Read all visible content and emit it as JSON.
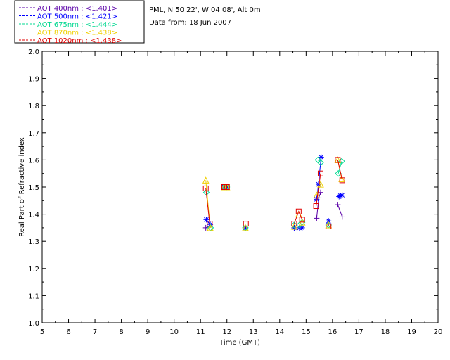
{
  "header": {
    "site_line": "PML, N 50 22', W 04 08', Alt 0m",
    "date_line": "Data from: 18 Jun 2007"
  },
  "chart_data": {
    "type": "scatter",
    "title": "",
    "xlabel": "Time (GMT)",
    "ylabel": "Real Part of Refractive index",
    "xlim": [
      5,
      20
    ],
    "ylim": [
      1.0,
      2.0
    ],
    "x_ticks": [
      5,
      6,
      7,
      8,
      9,
      10,
      11,
      12,
      13,
      14,
      15,
      16,
      17,
      18,
      19,
      20
    ],
    "y_ticks": [
      "1.0",
      "1.1",
      "1.2",
      "1.3",
      "1.4",
      "1.5",
      "1.6",
      "1.7",
      "1.8",
      "1.9",
      "2.0"
    ],
    "grid": false,
    "legend_position": "top-left",
    "series": [
      {
        "name": "AOT  400nm : <1.401>",
        "color": "#5a00a8",
        "marker": "plus",
        "segments": [
          [
            [
              11.2,
              1.35
            ],
            [
              11.35,
              1.355
            ]
          ],
          [
            [
              15.4,
              1.385
            ],
            [
              15.48,
              1.46
            ],
            [
              15.55,
              1.48
            ]
          ],
          [
            [
              16.2,
              1.435
            ],
            [
              16.37,
              1.39
            ]
          ]
        ],
        "points": [
          [
            11.9,
            1.5
          ],
          [
            12.0,
            1.5
          ],
          [
            12.7,
            1.35
          ],
          [
            14.55,
            1.35
          ],
          [
            14.75,
            1.35
          ],
          [
            15.85,
            1.365
          ]
        ]
      },
      {
        "name": "AOT  500nm : <1.421>",
        "color": "#0000ff",
        "marker": "asterisk",
        "segments": [
          [
            [
              11.22,
              1.38
            ],
            [
              11.37,
              1.362
            ]
          ],
          [
            [
              15.4,
              1.455
            ],
            [
              15.47,
              1.51
            ],
            [
              15.57,
              1.61
            ]
          ],
          [
            [
              16.25,
              1.465
            ],
            [
              16.3,
              1.468
            ],
            [
              16.37,
              1.47
            ]
          ]
        ],
        "points": [
          [
            11.9,
            1.5
          ],
          [
            12.0,
            1.5
          ],
          [
            12.7,
            1.35
          ],
          [
            14.55,
            1.35
          ],
          [
            14.75,
            1.35
          ],
          [
            14.85,
            1.35
          ],
          [
            15.85,
            1.375
          ]
        ]
      },
      {
        "name": "AOT  675nm : <1.444>",
        "color": "#00d890",
        "marker": "diamond",
        "segments": [
          [
            [
              11.22,
              1.48
            ],
            [
              11.38,
              1.35
            ]
          ],
          [
            [
              15.45,
              1.6
            ],
            [
              15.55,
              1.59
            ]
          ],
          [
            [
              16.22,
              1.55
            ],
            [
              16.35,
              1.595
            ]
          ]
        ],
        "points": [
          [
            11.9,
            1.5
          ],
          [
            12.0,
            1.5
          ],
          [
            12.7,
            1.35
          ],
          [
            14.55,
            1.36
          ],
          [
            14.75,
            1.36
          ],
          [
            14.85,
            1.37
          ],
          [
            15.85,
            1.36
          ]
        ]
      },
      {
        "name": "AOT  870nm : <1.438>",
        "color": "#f0d000",
        "marker": "triangle",
        "segments": [
          [
            [
              11.2,
              1.525
            ],
            [
              11.37,
              1.35
            ]
          ],
          [
            [
              15.4,
              1.47
            ],
            [
              15.55,
              1.51
            ]
          ],
          [
            [
              16.2,
              1.6
            ],
            [
              16.35,
              1.53
            ]
          ]
        ],
        "points": [
          [
            11.9,
            1.5
          ],
          [
            12.0,
            1.5
          ],
          [
            12.7,
            1.35
          ],
          [
            14.55,
            1.355
          ],
          [
            14.72,
            1.4
          ],
          [
            14.85,
            1.37
          ],
          [
            15.85,
            1.36
          ]
        ]
      },
      {
        "name": "AOT 1020nm : <1.438>",
        "color": "#e00000",
        "marker": "square",
        "segments": [
          [
            [
              11.2,
              1.495
            ],
            [
              11.35,
              1.365
            ]
          ],
          [
            [
              14.55,
              1.365
            ],
            [
              14.72,
              1.41
            ],
            [
              14.85,
              1.38
            ]
          ],
          [
            [
              15.38,
              1.43
            ],
            [
              15.55,
              1.55
            ]
          ],
          [
            [
              16.2,
              1.6
            ],
            [
              16.37,
              1.525
            ]
          ]
        ],
        "points": [
          [
            11.9,
            1.5
          ],
          [
            12.0,
            1.5
          ],
          [
            12.72,
            1.365
          ],
          [
            15.85,
            1.355
          ]
        ]
      }
    ]
  }
}
